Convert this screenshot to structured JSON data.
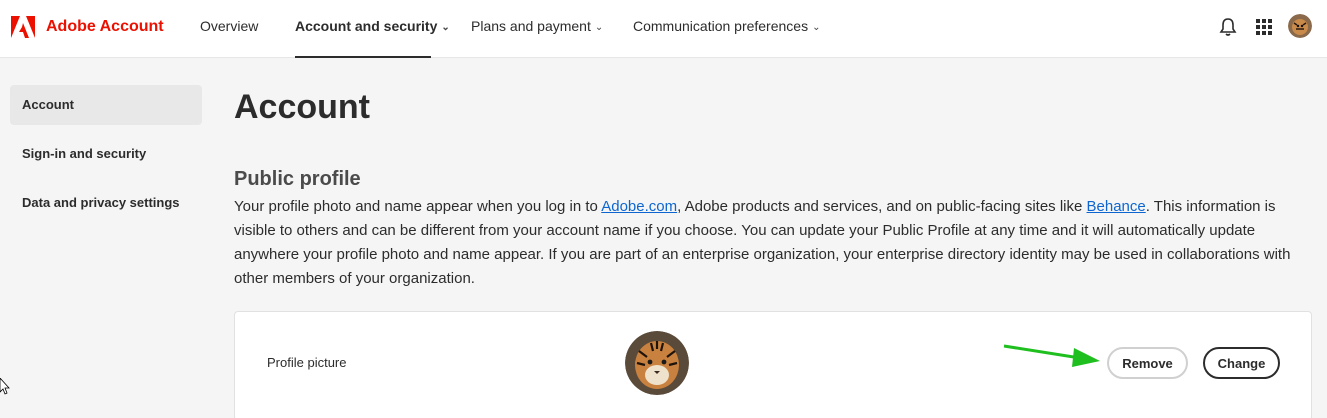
{
  "brand": {
    "name": "Adobe Account",
    "color": "#eb1000",
    "icon": "adobe-logo-icon"
  },
  "nav": {
    "items": [
      {
        "label": "Overview",
        "has_menu": false,
        "active": false
      },
      {
        "label": "Account and security",
        "has_menu": true,
        "active": true
      },
      {
        "label": "Plans and payment",
        "has_menu": true,
        "active": false
      },
      {
        "label": "Communication preferences",
        "has_menu": true,
        "active": false
      }
    ],
    "icons": [
      "bell-icon",
      "apps-grid-icon",
      "profile-avatar-icon"
    ]
  },
  "sidebar": {
    "items": [
      {
        "label": "Account",
        "active": true
      },
      {
        "label": "Sign-in and security",
        "active": false
      },
      {
        "label": "Data and privacy settings",
        "active": false
      }
    ]
  },
  "main": {
    "title": "Account",
    "public_profile": {
      "title": "Public profile",
      "desc_part1": "Your profile photo and name appear when you log in to ",
      "link1": "Adobe.com",
      "desc_part2": ", Adobe products and services, and on public-facing sites like ",
      "link2": "Behance",
      "desc_part3": ". This information is visible to others and can be different from your account name if you choose. You can update your Public Profile at any time and it will automatically update anywhere your profile photo and name appear. If you are part of an enterprise organization, your enterprise directory identity may be used in collaborations with other members of your organization."
    },
    "profile_card": {
      "label": "Profile picture",
      "remove_label": "Remove",
      "change_label": "Change",
      "image": "tiger-photo"
    }
  },
  "annotation": {
    "arrow_color": "#1fbf1f"
  }
}
